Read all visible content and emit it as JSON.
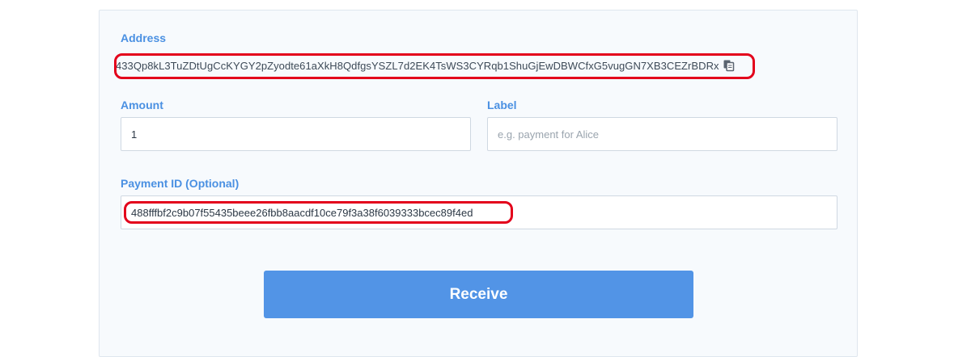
{
  "receive_form": {
    "address_label": "Address",
    "address_value": "433Qp8kL3TuZDtUgCcKYGY2pZyodte61aXkH8QdfgsYSZL7d2EK4TsWS3CYRqb1ShuGjEwDBWCfxG5vugGN7XB3CEZrBDRx",
    "amount_label": "Amount",
    "amount_value": "1",
    "label_label": "Label",
    "label_placeholder": "e.g. payment for Alice",
    "payment_id_label": "Payment ID (Optional)",
    "payment_id_value": "488fffbf2c9b07f55435beee26fbb8aacdf10ce79f3a38f6039333bcec89f4ed",
    "receive_button": "Receive"
  },
  "icons": {
    "copy": "copy-icon"
  },
  "colors": {
    "accent": "#4a90e2",
    "button": "#5294e6",
    "highlight": "#e3001b"
  }
}
